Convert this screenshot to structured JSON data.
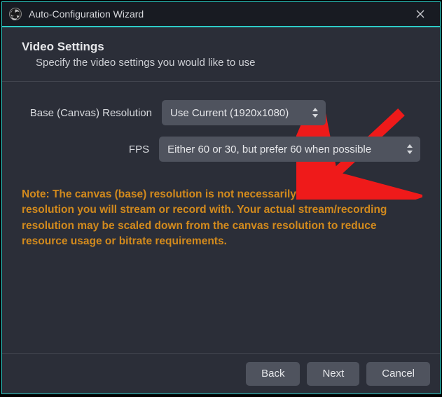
{
  "titlebar": {
    "title": "Auto-Configuration Wizard"
  },
  "header": {
    "title": "Video Settings",
    "subtitle": "Specify the video settings you would like to use"
  },
  "form": {
    "resolution_label": "Base (Canvas) Resolution",
    "resolution_value": "Use Current (1920x1080)",
    "fps_label": "FPS",
    "fps_value": "Either 60 or 30, but prefer 60 when possible"
  },
  "note_text": "Note: The canvas (base) resolution is not necessarily the same as the resolution you will stream or record with. Your actual stream/recording resolution may be scaled down from the canvas resolution to reduce resource usage or bitrate requirements.",
  "footer": {
    "back": "Back",
    "next": "Next",
    "cancel": "Cancel"
  }
}
